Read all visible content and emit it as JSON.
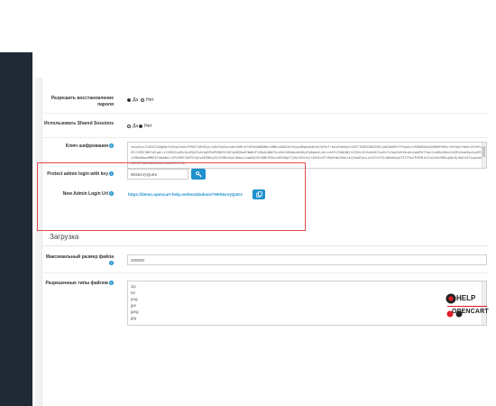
{
  "settings": {
    "allow_reset_password": {
      "label": "Разрешить восстановление пароля",
      "options": [
        "Да",
        "Нет"
      ],
      "selected": "Да"
    },
    "use_shared_sessions": {
      "label": "Использовать Shared Sessions",
      "options": [
        "Да",
        "Нет"
      ],
      "selected": "Нет"
    },
    "encryption_key": {
      "label": "Ключ шифрования",
      "value": "uwnuA2ys7CaEO21GqQgRdrFpGhg2nbVwrFH9kF2dEhFQjhjs0bS3qXGvuvd8ikHMldt7dFGn0dB80N6zrOBNeiaUKUJkcIdyuuBRgkbGwRcQVfmFRzTrkb2oFWeDqXnl6SE7TkDH32NeSIEDVjAN20WhM7JFCPqkExJvPAB0GUkQxOGMdQPfdRkrxRz5bQrfkHkh1GFd9lwOFLl5P0ZlBKFxDlgmlrxlyRDGXLp65xIqi69pZSwhIkgRFDdPEOBZ9IrDGYqhNGGmd7HmWkJFtHDpA1dNb73Ln60rAOXmkbcWx0Oyd7gBsbenLn0rzzktPiZfbNzWEjhlSEkUiZLKuaXdtZlwvRiYsYmaJ4o9tHcqhnLmmZPoTYhpt2xdkRxZdOa1IAZKhJomn9gsQzp0FQJv9RmV8mwsMMNTEZh6wWmCLcGPzE3MfJXW79IVgYzmFU9BzqZAJVZHBzJ0yk1NdwLzJqoKdQIDYUQNYI85kxv6K5SWgCTjHVuYR3V4sjC4UH3xnPT1MqhTmbC0GmLsk2jHmAPydsLoIAYSiVTXCnWRkmGnyE7Z27FbuYPdTM4tkILb3zSmrM5ULqQ8rNjXWyFsAYIyqknmZSKEY0TTqN5CWUVbJQiXvl8ukPRtlFhG"
    },
    "protect_admin_login_key": {
      "label": "Protect admin login with key",
      "value": "9Kk6xVyQuKe"
    },
    "new_admin_login_url": {
      "label": "New Admin Login Url",
      "value": "https://demo.opencart-help.net/test3/admin/?9Kk6xVyQuKe"
    },
    "section_upload": "Загрузка",
    "max_file_size": {
      "label": "Максимальный размер файла",
      "value": "300000"
    },
    "allowed_file_types": {
      "label": "Разрешенные типы файлов",
      "items": [
        "zip",
        "txt",
        "png",
        "jpe",
        "jpeg",
        "jpg"
      ]
    }
  },
  "logo": {
    "top": "HELP",
    "bottom": "OPENCART"
  },
  "colors": {
    "accent": "#1e91cf",
    "sidebar": "#1f2a36",
    "highlight": "#e0484b"
  }
}
